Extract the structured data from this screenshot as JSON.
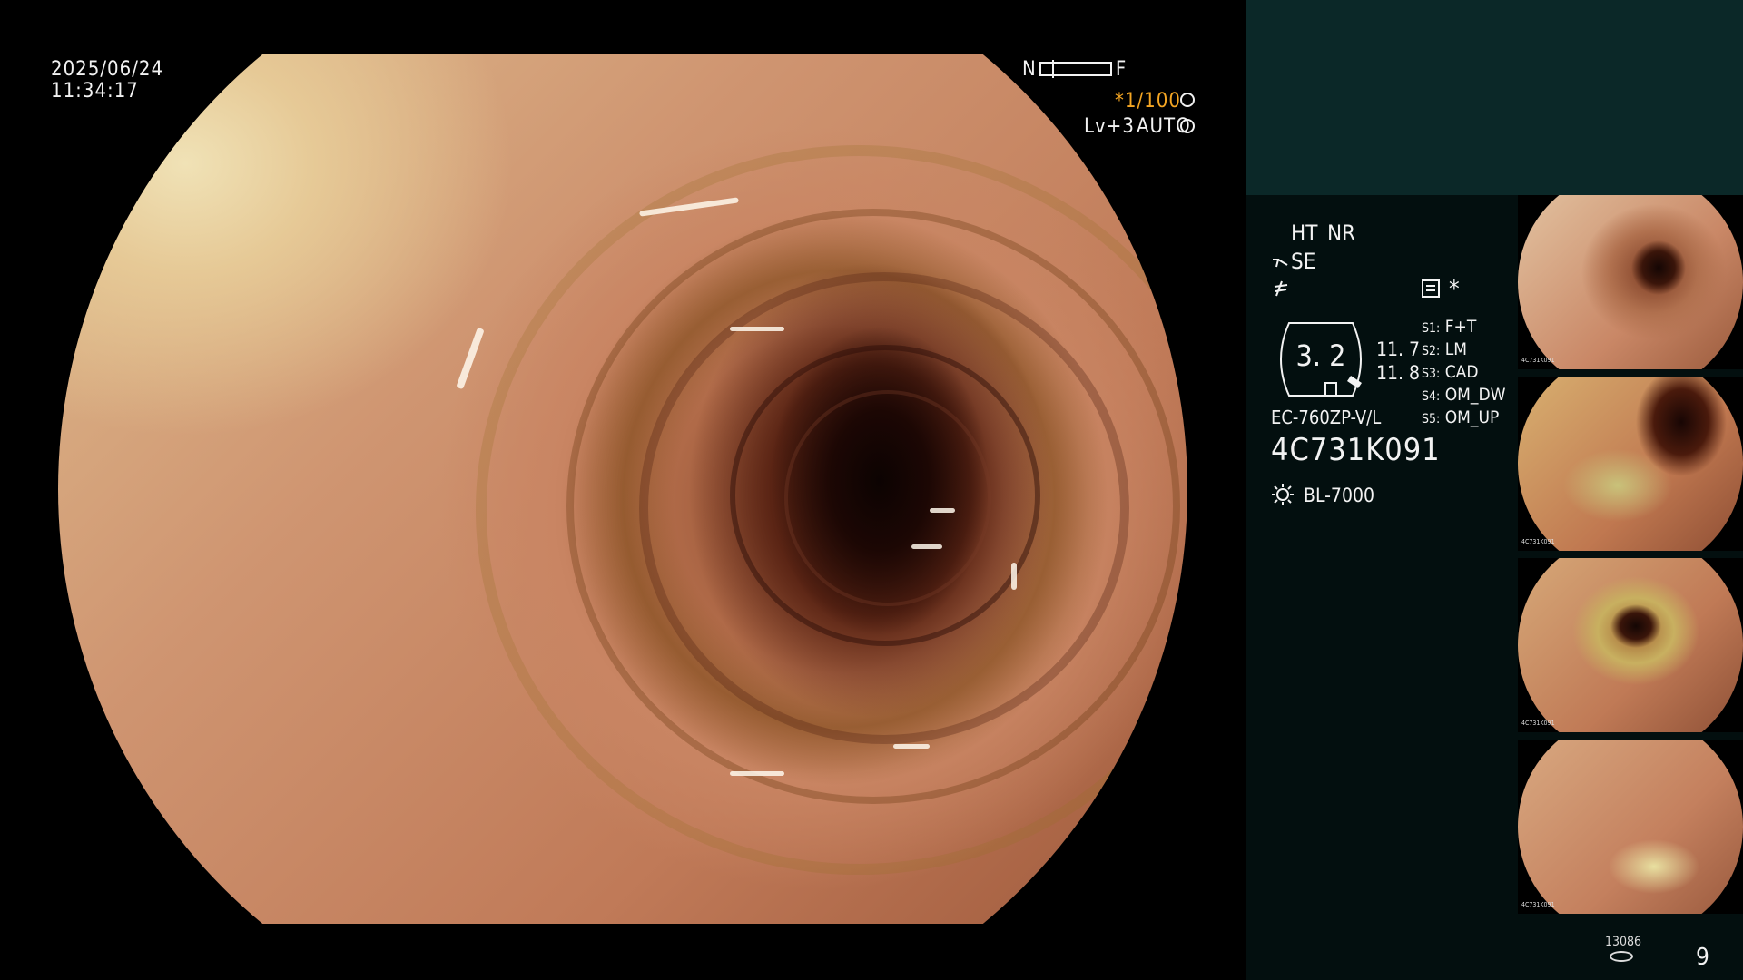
{
  "overlay": {
    "date": "2025/06/24",
    "time": "11:34:17",
    "focus_near": "N",
    "focus_far": "F",
    "shutter": "*1/100",
    "level": "Lv+3",
    "iris_mode": "AUTO"
  },
  "panel": {
    "ht_label": "HT",
    "nr_label": "NR",
    "se_label": "SE",
    "record_star": "*",
    "ratio": "3. 2",
    "value_1": "11. 7",
    "value_2": "11. 8",
    "scope_model": "EC-760ZP-V/L",
    "serial": "4C731K091",
    "light_source": "BL-7000",
    "switches": [
      {
        "key": "S1",
        "value": "F+T"
      },
      {
        "key": "S2",
        "value": "LM"
      },
      {
        "key": "S3",
        "value": "CAD"
      },
      {
        "key": "S4",
        "value": "OM_DW"
      },
      {
        "key": "S5",
        "value": "OM_UP"
      }
    ]
  },
  "thumbnails": [
    {
      "id": "1"
    },
    {
      "id": "2"
    },
    {
      "id": "3"
    },
    {
      "id": "4"
    }
  ],
  "thumbnail_caption": "4C731K091",
  "footer": {
    "image_count": "13086",
    "page": "9"
  },
  "colors": {
    "accent": "#f5a623",
    "panel_bg": "#030f0f",
    "header_bg": "#0b2828"
  }
}
